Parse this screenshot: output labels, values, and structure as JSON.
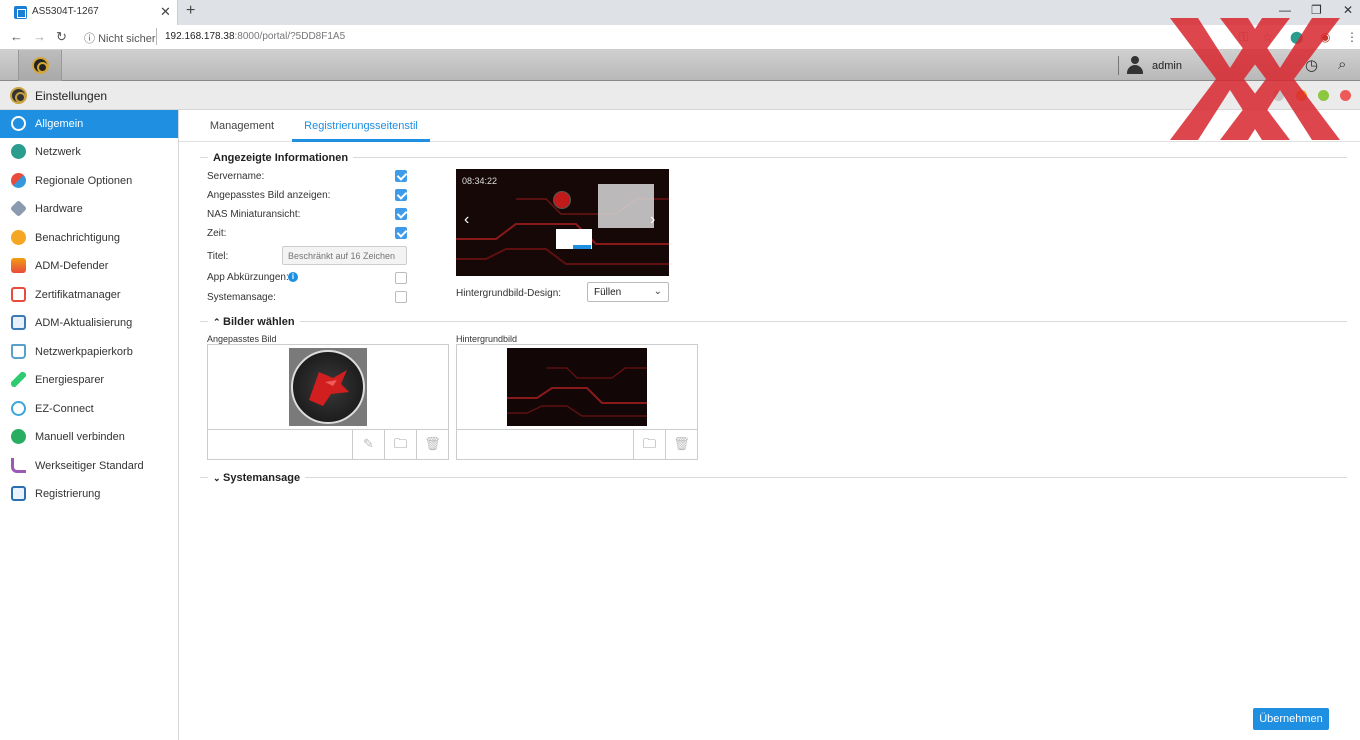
{
  "browser": {
    "tab_title": "AS5304T-1267",
    "security_label": "Nicht sicher",
    "url_host": "192.168.178.38",
    "url_rest": ":8000/portal/?5DD8F1A5"
  },
  "toolbar": {
    "user": "admin"
  },
  "window": {
    "title": "Einstellungen"
  },
  "sidebar": {
    "items": [
      {
        "label": "Allgemein",
        "icon": "general-icon",
        "color": "#ffffff"
      },
      {
        "label": "Netzwerk",
        "icon": "network-icon",
        "color": "#2a9d8f"
      },
      {
        "label": "Regionale Optionen",
        "icon": "regional-icon",
        "color": "#e74c3c"
      },
      {
        "label": "Hardware",
        "icon": "hardware-icon",
        "color": "#8a9bb0"
      },
      {
        "label": "Benachrichtigung",
        "icon": "notification-icon",
        "color": "#f5a623"
      },
      {
        "label": "ADM-Defender",
        "icon": "defender-icon",
        "color": "#e67e22"
      },
      {
        "label": "Zertifikatmanager",
        "icon": "certificate-icon",
        "color": "#e74c3c"
      },
      {
        "label": "ADM-Aktualisierung",
        "icon": "update-icon",
        "color": "#3d7ab5"
      },
      {
        "label": "Netzwerkpapierkorb",
        "icon": "recycle-icon",
        "color": "#5aa0c8"
      },
      {
        "label": "Energiesparer",
        "icon": "energy-icon",
        "color": "#2ecc71"
      },
      {
        "label": "EZ-Connect",
        "icon": "cloud-icon",
        "color": "#3da5d9"
      },
      {
        "label": "Manuell verbinden",
        "icon": "connect-icon",
        "color": "#27ae60"
      },
      {
        "label": "Werkseitiger Standard",
        "icon": "reset-icon",
        "color": "#9b59b6"
      },
      {
        "label": "Registrierung",
        "icon": "registration-icon",
        "color": "#2c6fb0"
      }
    ]
  },
  "tabs": [
    "Management",
    "Registrierungsseitenstil"
  ],
  "displayed_info": {
    "title": "Angezeigte Informationen",
    "servername_label": "Servername:",
    "custom_image_label": "Angepasstes Bild anzeigen:",
    "nas_thumbnail_label": "NAS Miniaturansicht:",
    "time_label": "Zeit:",
    "title_label": "Titel:",
    "title_placeholder": "Beschränkt auf 16 Zeichen",
    "app_shortcuts_label": "App Abkürzungen:",
    "announcement_label": "Systemansage:",
    "preview_clock": "08:34:22",
    "background_design_label": "Hintergrundbild-Design:",
    "background_design_value": "Füllen"
  },
  "images": {
    "title": "Bilder wählen",
    "custom_image_label": "Angepasstes Bild",
    "background_label": "Hintergrundbild"
  },
  "announcement_section": {
    "title": "Systemansage"
  },
  "apply_label": "Übernehmen"
}
